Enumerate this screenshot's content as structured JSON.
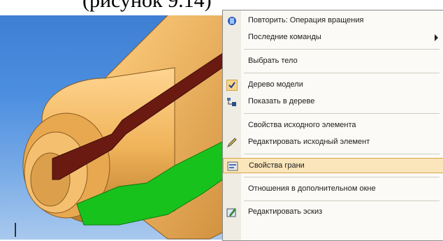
{
  "top_text": "(рисунок 9.14)",
  "context_menu": {
    "items": [
      {
        "label": "Повторить: Операция вращения",
        "icon": "repeat-icon"
      },
      {
        "label": "Последние команды",
        "icon": null,
        "submenu": true
      },
      {
        "label": "Выбрать тело",
        "icon": null
      },
      {
        "label": "Дерево модели",
        "icon": "checkmark-icon",
        "checked": true
      },
      {
        "label": "Показать в дереве",
        "icon": "show-in-tree-icon"
      },
      {
        "label": "Свойства исходного элемента",
        "icon": null
      },
      {
        "label": "Редактировать исходный элемент",
        "icon": "edit-pencil-icon"
      },
      {
        "label": "Свойства грани",
        "icon": "face-properties-icon",
        "highlighted": true
      },
      {
        "label": "Отношения в дополнительном окне",
        "icon": null
      },
      {
        "label": "Редактировать эскиз",
        "icon": "edit-sketch-icon"
      }
    ]
  },
  "colors": {
    "background_top": "#3f7fd3",
    "part_body": "#f0b45a",
    "cut_face": "#6b1a12",
    "selected_face": "#18c21c",
    "menu_highlight": "#fbe6bb"
  }
}
